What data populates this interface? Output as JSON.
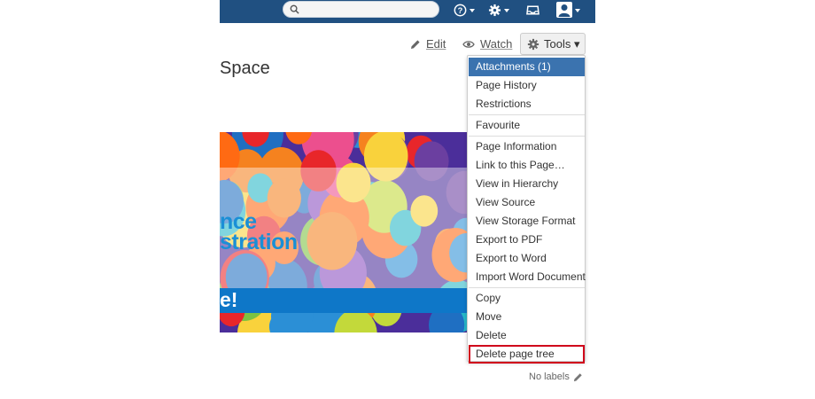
{
  "header": {
    "search": {
      "value": "",
      "placeholder": ""
    },
    "help_icon": "help-icon",
    "settings_icon": "gear-icon",
    "notifications_icon": "inbox-icon",
    "user_icon": "user-icon"
  },
  "actions": {
    "edit_label": "Edit",
    "watch_label": "Watch",
    "tools_label": "Tools ▾"
  },
  "page": {
    "title": "Space",
    "banner_line1": "nce",
    "banner_line2": "stration",
    "banner_bar_text": "e!"
  },
  "tools_menu": {
    "groups": [
      [
        "Attachments (1)",
        "Page History",
        "Restrictions"
      ],
      [
        "Favourite"
      ],
      [
        "Page Information",
        "Link to this Page…",
        "View in Hierarchy",
        "View Source",
        "View Storage Format",
        "Export to PDF",
        "Export to Word",
        "Import Word Document"
      ],
      [
        "Copy",
        "Move",
        "Delete",
        "Delete page tree"
      ]
    ],
    "active_item": "Attachments (1)",
    "highlighted_item": "Delete page tree"
  },
  "footer": {
    "labels_text": "No labels"
  },
  "colors": {
    "header_bg": "#205081",
    "menu_active": "#3b73af",
    "highlight_border": "#d0021b",
    "banner_blue": "#0e77c8"
  }
}
